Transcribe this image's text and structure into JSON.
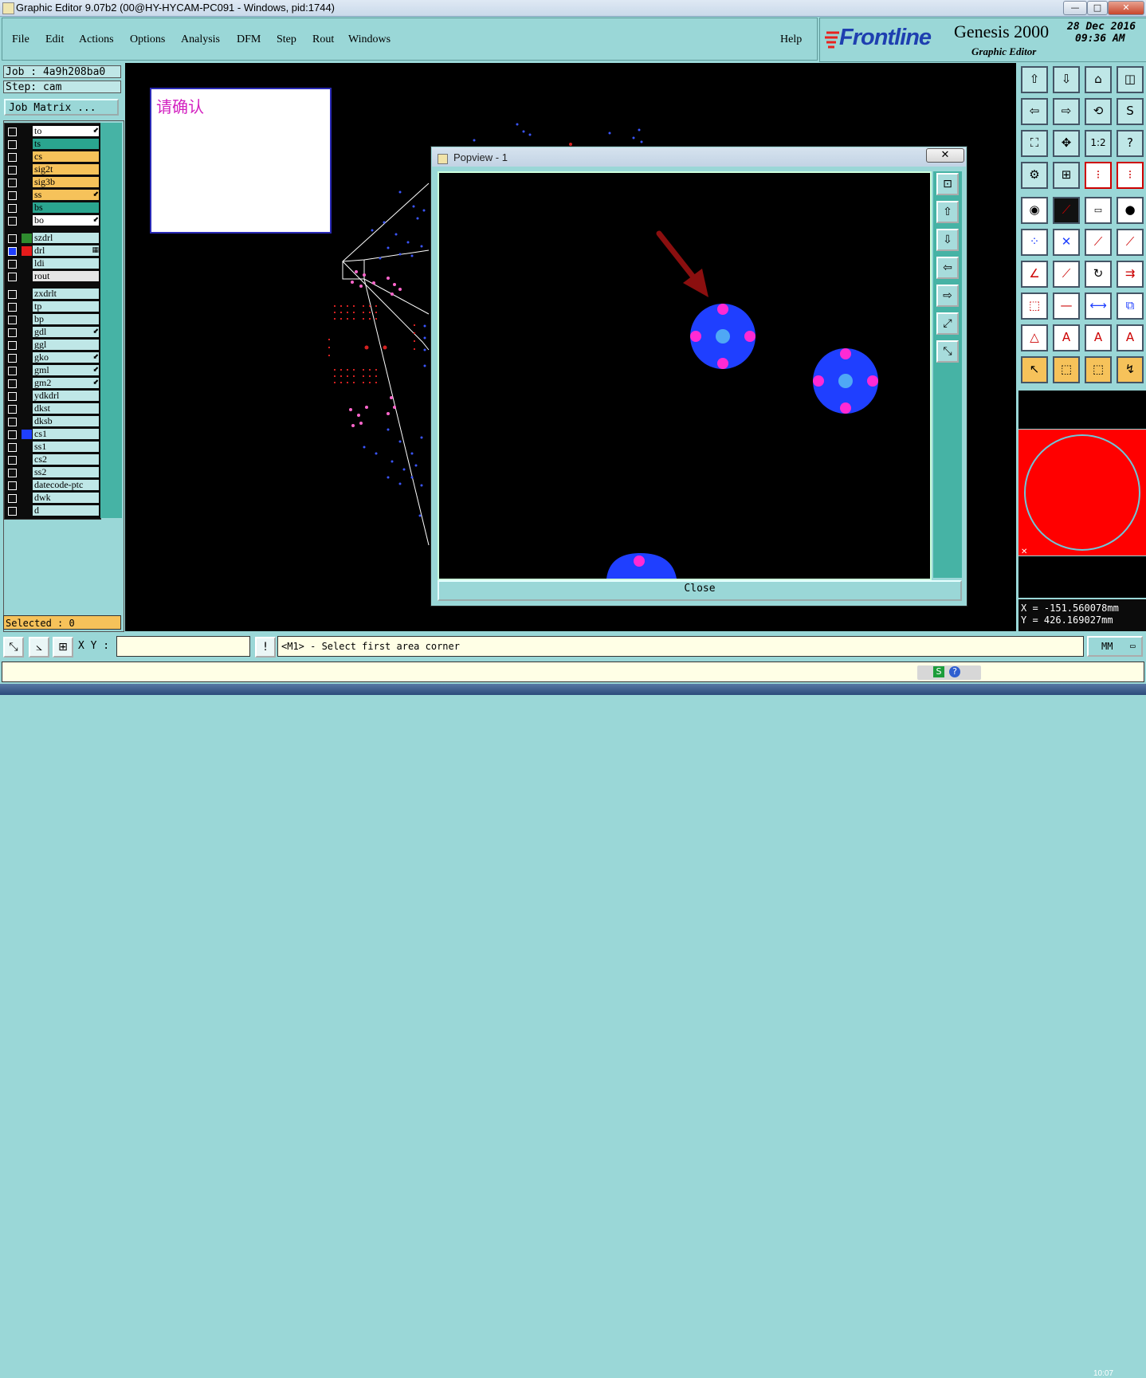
{
  "window": {
    "title": "Graphic Editor 9.07b2 (00@HY-HYCAM-PC091 - Windows, pid:1744)",
    "min": "—",
    "max": "□",
    "close": "✕"
  },
  "menu": {
    "items": [
      "File",
      "Edit",
      "Actions",
      "Options",
      "Analysis",
      "DFM",
      "Step",
      "Rout",
      "Windows"
    ],
    "help": "Help"
  },
  "logo": {
    "brand": "Frontline",
    "product": "Genesis 2000",
    "subtitle": "Graphic Editor",
    "date": "28 Dec 2016",
    "time": "09:36 AM"
  },
  "job": {
    "job_line": "Job : 4a9h208ba0",
    "step_line": "Step: cam",
    "matrix_button": "Job Matrix ..."
  },
  "layers": [
    {
      "name": "to",
      "color": "#ffffff",
      "mark": "⬋"
    },
    {
      "name": "ts",
      "color": "#2aa58f",
      "mark": ""
    },
    {
      "name": "cs",
      "color": "#f6c25a",
      "mark": ""
    },
    {
      "name": "sig2t",
      "color": "#f6c25a",
      "mark": ""
    },
    {
      "name": "sig3b",
      "color": "#f6c25a",
      "mark": ""
    },
    {
      "name": "ss",
      "color": "#f6c25a",
      "mark": "⬋"
    },
    {
      "name": "bs",
      "color": "#2aa58f",
      "mark": ""
    },
    {
      "name": "bo",
      "color": "#ffffff",
      "mark": "⬋"
    },
    {
      "name": "szdrl",
      "color": "#bfe7e7",
      "mark": "",
      "swatch": "#2e8b2e"
    },
    {
      "name": "drl",
      "color": "#bfe7e7",
      "mark": "▦",
      "swatch": "#e51b1b",
      "checked": true
    },
    {
      "name": "ldi",
      "color": "#bfe7e7",
      "mark": ""
    },
    {
      "name": "rout",
      "color": "#e6e6e6",
      "mark": ""
    },
    {
      "name": "zxdrlt",
      "color": "#bfe7e7",
      "mark": ""
    },
    {
      "name": "tp",
      "color": "#bfe7e7",
      "mark": ""
    },
    {
      "name": "bp",
      "color": "#bfe7e7",
      "mark": ""
    },
    {
      "name": "gdl",
      "color": "#bfe7e7",
      "mark": "⬋"
    },
    {
      "name": "ggl",
      "color": "#bfe7e7",
      "mark": ""
    },
    {
      "name": "gko",
      "color": "#bfe7e7",
      "mark": "⬋"
    },
    {
      "name": "gml",
      "color": "#bfe7e7",
      "mark": "⬋"
    },
    {
      "name": "gm2",
      "color": "#bfe7e7",
      "mark": "⬋"
    },
    {
      "name": "ydkdrl",
      "color": "#bfe7e7",
      "mark": ""
    },
    {
      "name": "dkst",
      "color": "#bfe7e7",
      "mark": ""
    },
    {
      "name": "dksb",
      "color": "#bfe7e7",
      "mark": ""
    },
    {
      "name": "cs1",
      "color": "#bfe7e7",
      "mark": "",
      "swatch": "#1f3fff"
    },
    {
      "name": "ss1",
      "color": "#bfe7e7",
      "mark": ""
    },
    {
      "name": "cs2",
      "color": "#bfe7e7",
      "mark": ""
    },
    {
      "name": "ss2",
      "color": "#bfe7e7",
      "mark": ""
    },
    {
      "name": "datecode-ptc",
      "color": "#bfe7e7",
      "mark": ""
    },
    {
      "name": "dwk",
      "color": "#bfe7e7",
      "mark": ""
    },
    {
      "name": "d",
      "color": "#bfe7e7",
      "mark": ""
    }
  ],
  "selected": "Selected : 0",
  "confirm": {
    "text": "请确认"
  },
  "popview": {
    "title": "Popview - 1",
    "close_x": "✕",
    "close_button": "Close"
  },
  "coords": {
    "x": "X = -151.560078mm",
    "y": "Y = 426.169027mm"
  },
  "bottom": {
    "xy_label": "X Y :",
    "xy_value": "",
    "message": "<M1> - Select first area corner",
    "units": "MM",
    "bang": "!"
  },
  "taskbar": {
    "clock": "10:07"
  },
  "colors": {
    "panel": "#9ad7d7",
    "canvas": "#000000",
    "pad_blue": "#1f3fff",
    "pad_magenta": "#ff2ad4",
    "arrow": "#8b0f0f"
  }
}
